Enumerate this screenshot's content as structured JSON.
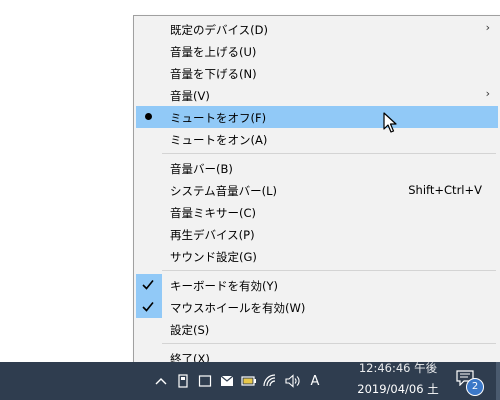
{
  "menu": {
    "items": [
      {
        "label": "既定のデバイス(D)",
        "submenu": true
      },
      {
        "label": "音量を上げる(U)"
      },
      {
        "label": "音量を下げる(N)"
      },
      {
        "label": "音量(V)",
        "submenu": true
      },
      {
        "label": "ミュートをオフ(F)",
        "selected": true,
        "highlighted": true
      },
      {
        "label": "ミュートをオン(A)"
      },
      {
        "label": "音量バー(B)"
      },
      {
        "label": "システム音量バー(L)",
        "shortcut": "Shift+Ctrl+V"
      },
      {
        "label": "音量ミキサー(C)"
      },
      {
        "label": "再生デバイス(P)"
      },
      {
        "label": "サウンド設定(G)"
      },
      {
        "label": "キーボードを有効(Y)",
        "checked": true
      },
      {
        "label": "マウスホイールを有効(W)",
        "checked": true
      },
      {
        "label": "設定(S)"
      },
      {
        "label": "終了(X)"
      }
    ],
    "submenu_arrow": "›"
  },
  "taskbar": {
    "tray_icons": [
      "chevron-up-icon",
      "device-icon",
      "window-icon",
      "mail-icon",
      "battery-icon",
      "network-icon",
      "speaker-icon",
      "ime-icon"
    ],
    "speaker_glyph": "🔊",
    "ime_glyph": "A",
    "chevron_glyph": "^",
    "time": "12:46:46 午後",
    "date": "2019/04/06 土",
    "notification_count": "2"
  },
  "colors": {
    "highlight": "#91c9f7",
    "menu_bg": "#f2f2f2",
    "taskbar_bg": "#2f3d4f"
  }
}
